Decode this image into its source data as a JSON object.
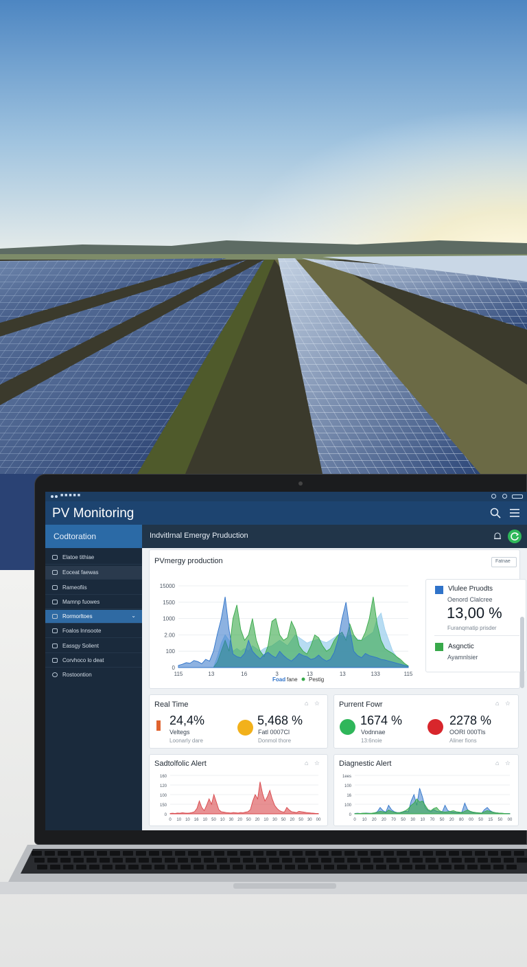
{
  "window": {
    "status_text": "■ ■ ■ ■ ■"
  },
  "app": {
    "title": "PV Monitoring"
  },
  "sidebar": {
    "header": "Codtoration",
    "items": [
      {
        "label": "Elatoe tithiae"
      },
      {
        "label": "Eoceat faewas"
      },
      {
        "label": "Rameofiis"
      },
      {
        "label": "Mamnp fuowes"
      },
      {
        "label": "Rormorltoes"
      },
      {
        "label": "Foalos lnnsoote"
      },
      {
        "label": "Eassgy Solient"
      },
      {
        "label": "Corvhoco lo deat"
      },
      {
        "label": "Rostoontion"
      }
    ]
  },
  "content": {
    "title": "Indvitlrnal Emergy Pruduction"
  },
  "production_card": {
    "title": "PVmergy production",
    "period_button": "Fatnae",
    "legend_label_a": "Foad",
    "legend_label_b": "fane",
    "legend_label_c": "Pestig",
    "series_colors": [
      "#2f73c9",
      "#38a94a",
      "#9fd0ee",
      "#8bd06a"
    ]
  },
  "legend_card": {
    "item1_title": "Vlulee Pruodts",
    "item1_subtitle": "Oenord Clalcree",
    "item1_value": "13,00 %",
    "item1_note": "Furanqmatip prisder",
    "item2_title": "Asgnctic",
    "item2_note": "Ayamnlsier",
    "item1_color": "#2f73c9",
    "item2_color": "#38a94a"
  },
  "realtime_card": {
    "title": "Real Time",
    "kpi1": {
      "value": "24,4%",
      "label": "Veltegs",
      "sub": "Loonarly dare",
      "color": "#e0632e"
    },
    "kpi2": {
      "value": "5,468 %",
      "label": "Fatl 0007Cl",
      "sub": "Donmol thore",
      "color": "#f2b11b"
    }
  },
  "power_card": {
    "title": "Purrent Fowr",
    "kpi1": {
      "value": "1674 %",
      "label": "Vodnnae",
      "sub": "13:6noie",
      "color": "#2fb65a"
    },
    "kpi2": {
      "value": "2278 %",
      "label": "ООRI 000Tls",
      "sub": "Aliner fions",
      "color": "#d8262c"
    }
  },
  "alert_card": {
    "title": "Sadtolfolic Alert"
  },
  "diag_card": {
    "title": "Diagnestic Alert"
  },
  "chart_data": [
    {
      "type": "area",
      "title": "PVmergy production",
      "y_ticks": [
        "15000",
        "1500",
        "1000",
        "2.00",
        "100",
        "0"
      ],
      "x_ticks": [
        "115",
        "13",
        "16",
        "3",
        "13",
        "13",
        "133",
        "115"
      ],
      "ylim": [
        0,
        1500
      ],
      "x": [
        0,
        1,
        2,
        3,
        4,
        5,
        6,
        7,
        8,
        9,
        10,
        11,
        12,
        13,
        14,
        15,
        16,
        17,
        18,
        19,
        20,
        21,
        22,
        23,
        24,
        25,
        26,
        27,
        28,
        29,
        30,
        31,
        32,
        33,
        34,
        35,
        36,
        37,
        38,
        39,
        40,
        41,
        42,
        43,
        44,
        45,
        46,
        47,
        48,
        49,
        50,
        51,
        52,
        53,
        54,
        55,
        56,
        57,
        58,
        59
      ],
      "series": [
        {
          "name": "Foad",
          "color": "#2f73c9",
          "values": [
            40,
            60,
            90,
            80,
            130,
            110,
            70,
            150,
            120,
            300,
            620,
            900,
            1300,
            700,
            250,
            200,
            180,
            260,
            500,
            300,
            220,
            160,
            240,
            280,
            220,
            180,
            300,
            220,
            160,
            120,
            180,
            260,
            220,
            200,
            150,
            170,
            230,
            160,
            120,
            150,
            280,
            520,
            900,
            1200,
            700,
            300,
            220,
            180,
            260,
            220,
            200,
            180,
            150,
            140,
            120,
            100,
            80,
            60,
            40,
            20
          ]
        },
        {
          "name": "fane",
          "color": "#38a94a",
          "values": [
            0,
            0,
            0,
            0,
            0,
            0,
            0,
            0,
            0,
            0,
            100,
            300,
            500,
            300,
            900,
            1150,
            700,
            500,
            600,
            900,
            500,
            300,
            200,
            400,
            850,
            900,
            600,
            500,
            550,
            850,
            700,
            400,
            300,
            250,
            400,
            600,
            550,
            400,
            300,
            350,
            500,
            600,
            650,
            500,
            800,
            600,
            500,
            500,
            650,
            900,
            1300,
            800,
            500,
            350,
            300,
            260,
            200,
            150,
            80,
            30
          ]
        },
        {
          "name": "Pestig",
          "color": "#9fd0ee",
          "values": [
            0,
            0,
            0,
            0,
            0,
            0,
            0,
            0,
            0,
            0,
            200,
            450,
            600,
            500,
            300,
            350,
            300,
            350,
            300,
            400,
            350,
            300,
            350,
            380,
            400,
            450,
            500,
            450,
            400,
            500,
            600,
            550,
            500,
            450,
            480,
            500,
            520,
            480,
            460,
            500,
            550,
            600,
            580,
            560,
            600,
            580,
            520,
            500,
            550,
            600,
            650,
            900,
            1000,
            700,
            500,
            300,
            200,
            120,
            60,
            20
          ]
        }
      ]
    },
    {
      "type": "area",
      "title": "Sadtolfolic Alert",
      "y_ticks": [
        "160",
        "120",
        "100",
        "150",
        "0"
      ],
      "x_ticks": [
        "0",
        "10",
        "10",
        "16",
        "10",
        "50",
        "10",
        "30",
        "20",
        "50",
        "20",
        "10",
        "30",
        "50",
        "20",
        "50",
        "30",
        "00"
      ],
      "ylim": [
        0,
        180
      ],
      "series": [
        {
          "name": "",
          "color": "#d8474b",
          "values": [
            2,
            3,
            2,
            4,
            3,
            5,
            4,
            3,
            4,
            6,
            10,
            25,
            60,
            30,
            15,
            40,
            70,
            45,
            90,
            55,
            20,
            10,
            8,
            6,
            5,
            4,
            6,
            5,
            4,
            6,
            5,
            8,
            10,
            20,
            60,
            90,
            70,
            150,
            95,
            60,
            80,
            110,
            70,
            40,
            25,
            15,
            10,
            8,
            30,
            18,
            10,
            8,
            6,
            12,
            10,
            8,
            6,
            5,
            4,
            3,
            2,
            2
          ]
        }
      ]
    },
    {
      "type": "area",
      "title": "Diagnestic Alert",
      "y_ticks": [
        "1ees",
        "100",
        "16",
        "100",
        "0"
      ],
      "x_ticks": [
        "0",
        "10",
        "20",
        "20",
        "70",
        "50",
        "30",
        "10",
        "70",
        "50",
        "20",
        "80",
        "00",
        "50",
        "15",
        "50",
        "00"
      ],
      "ylim": [
        0,
        180
      ],
      "series": [
        {
          "name": "",
          "color": "#2f73c9",
          "values": [
            2,
            3,
            2,
            3,
            4,
            3,
            2,
            4,
            10,
            30,
            15,
            8,
            40,
            20,
            10,
            6,
            5,
            8,
            12,
            10,
            60,
            90,
            40,
            120,
            80,
            30,
            15,
            10,
            20,
            12,
            10,
            8,
            40,
            15,
            10,
            8,
            6,
            5,
            8,
            50,
            20,
            10,
            6,
            5,
            4,
            3,
            20,
            30,
            15,
            8,
            5,
            4,
            3,
            2,
            2,
            2
          ]
        },
        {
          "name": "",
          "color": "#38a94a",
          "values": [
            1,
            2,
            2,
            3,
            3,
            2,
            3,
            5,
            8,
            12,
            10,
            6,
            18,
            12,
            8,
            5,
            6,
            10,
            15,
            25,
            40,
            50,
            70,
            55,
            60,
            40,
            20,
            15,
            25,
            30,
            15,
            10,
            8,
            10,
            12,
            15,
            10,
            8,
            6,
            12,
            18,
            12,
            8,
            6,
            5,
            4,
            10,
            15,
            12,
            8,
            5,
            4,
            3,
            2,
            1,
            1
          ]
        }
      ]
    }
  ]
}
